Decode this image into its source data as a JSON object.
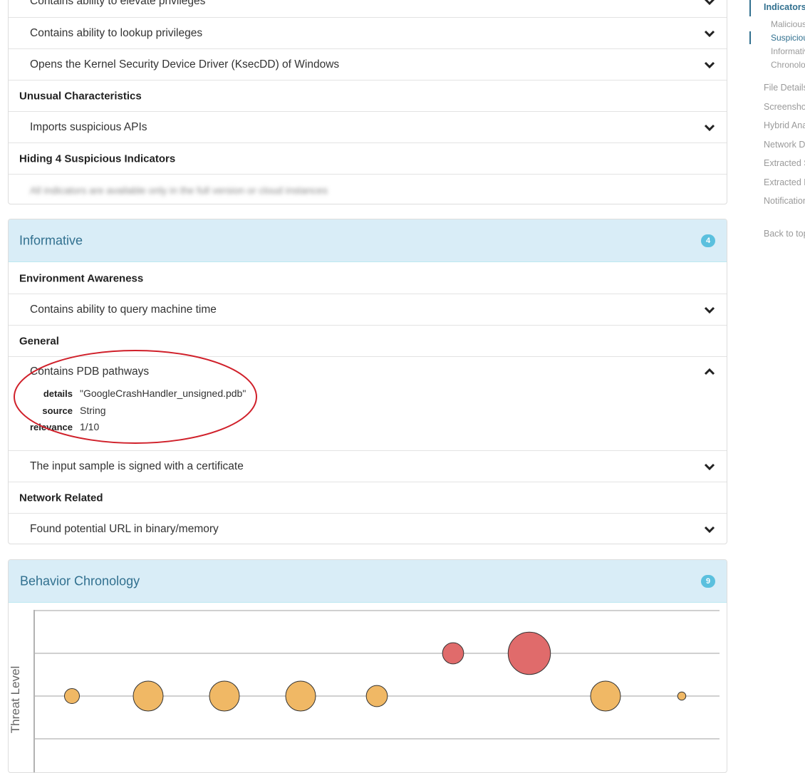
{
  "suspicious_panel": {
    "rows": [
      {
        "text": "Contains ability to elevate privileges",
        "type": "item"
      },
      {
        "text": "Contains ability to lookup privileges",
        "type": "item"
      },
      {
        "text": "Opens the Kernel Security Device Driver (KsecDD) of Windows",
        "type": "item"
      },
      {
        "text": "Unusual Characteristics",
        "type": "category"
      },
      {
        "text": "Imports suspicious APIs",
        "type": "item"
      },
      {
        "text": "Hiding 4 Suspicious Indicators",
        "type": "category"
      },
      {
        "text": "All indicators are available only in the full version or cloud instances",
        "type": "blurred"
      }
    ]
  },
  "informative_panel": {
    "title": "Informative",
    "badge": "4",
    "rows": [
      {
        "text": "Environment Awareness",
        "type": "category"
      },
      {
        "text": "Contains ability to query machine time",
        "type": "item"
      },
      {
        "text": "General",
        "type": "category"
      },
      {
        "text": "Contains PDB pathways",
        "type": "expanded"
      },
      {
        "text": "The input sample is signed with a certificate",
        "type": "item"
      },
      {
        "text": "Network Related",
        "type": "category"
      },
      {
        "text": "Found potential URL in binary/memory",
        "type": "item"
      }
    ],
    "expanded_details": {
      "details_label": "details",
      "details_value": "\"GoogleCrashHandler_unsigned.pdb\"",
      "source_label": "source",
      "source_value": "String",
      "relevance_label": "relevance",
      "relevance_value": "1/10"
    }
  },
  "chronology_panel": {
    "title": "Behavior Chronology",
    "badge": "9"
  },
  "chart_data": {
    "type": "scatter",
    "ylabel": "Threat Level",
    "points": [
      {
        "threat": 1,
        "size": 1,
        "color": "#f0b865"
      },
      {
        "threat": 1,
        "size": 4,
        "color": "#f0b865"
      },
      {
        "threat": 1,
        "size": 4,
        "color": "#f0b865"
      },
      {
        "threat": 1,
        "size": 4,
        "color": "#f0b865"
      },
      {
        "threat": 1,
        "size": 2,
        "color": "#f0b865"
      },
      {
        "threat": 2,
        "size": 2,
        "color": "#e06b6b"
      },
      {
        "threat": 2,
        "size": 8,
        "color": "#e06b6b"
      },
      {
        "threat": 1,
        "size": 4,
        "color": "#f0b865"
      },
      {
        "threat": 1,
        "size": 0.3,
        "color": "#f0b865"
      }
    ]
  },
  "nav": {
    "items": [
      {
        "label": "Indicators",
        "level": 0,
        "active": true
      },
      {
        "label": "Malicious",
        "level": 1
      },
      {
        "label": "Suspicious",
        "level": 1,
        "active": true
      },
      {
        "label": "Informative",
        "level": 1
      },
      {
        "label": "Chronology",
        "level": 1
      },
      {
        "label": "File Details",
        "level": 0
      },
      {
        "label": "Screenshots",
        "level": 0
      },
      {
        "label": "Hybrid Analysis",
        "level": 0
      },
      {
        "label": "Network Data",
        "level": 0
      },
      {
        "label": "Extracted Strings",
        "level": 0
      },
      {
        "label": "Extracted Files",
        "level": 0
      },
      {
        "label": "Notifications",
        "level": 0
      },
      {
        "label": "Back to top",
        "level": 0
      }
    ]
  }
}
